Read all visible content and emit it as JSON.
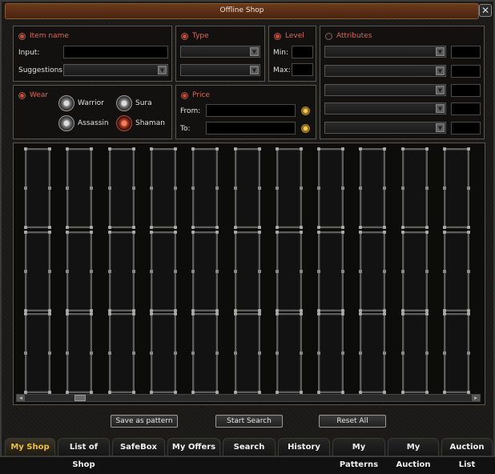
{
  "window": {
    "title": "Offline Shop",
    "close": "✕"
  },
  "item_name": {
    "title": "Item name",
    "input_label": "Input:",
    "suggestions_label": "Suggestions:"
  },
  "type": {
    "title": "Type"
  },
  "level": {
    "title": "Level",
    "min_label": "Min:",
    "max_label": "Max:"
  },
  "attributes": {
    "title": "Attributes"
  },
  "wear": {
    "title": "Wear",
    "classes": [
      "Warrior",
      "Sura",
      "Assassin",
      "Shaman"
    ]
  },
  "price": {
    "title": "Price",
    "from_label": "From:",
    "to_label": "To:"
  },
  "grid": {
    "columns": 11,
    "rows": 3
  },
  "scroll": {
    "left": "◂",
    "right": "▸"
  },
  "buttons": {
    "save": "Save as pattern",
    "search": "Start Search",
    "reset": "Reset All"
  },
  "tabs": [
    "My Shop",
    "List of Shop",
    "SafeBox",
    "My Offers",
    "Search",
    "History",
    "My Patterns",
    "My Auction",
    "Auction List"
  ],
  "active_tab": 0
}
